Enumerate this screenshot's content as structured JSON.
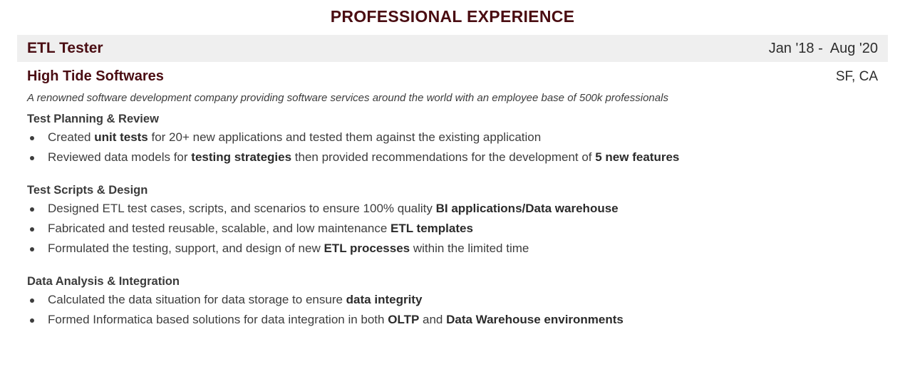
{
  "section": {
    "title": "PROFESSIONAL EXPERIENCE"
  },
  "colors": {
    "heading_maroon": "#4a0d12",
    "header_band_bg": "#efefef",
    "body_text": "#3d3d3d"
  },
  "entry": {
    "job_title": "ETL Tester",
    "dates": "Jan '18 -  Aug '20",
    "company": "High Tide Softwares",
    "location": "SF, CA",
    "description": "A renowned software development company providing software services around the world with an employee base of 500k professionals",
    "groups": [
      {
        "heading": "Test Planning & Review",
        "bullets": [
          [
            {
              "text": "Created ",
              "bold": false
            },
            {
              "text": "unit tests",
              "bold": true
            },
            {
              "text": " for 20+ new applications and tested them against the existing application",
              "bold": false
            }
          ],
          [
            {
              "text": "Reviewed data models for ",
              "bold": false
            },
            {
              "text": "testing strategies",
              "bold": true
            },
            {
              "text": " then provided recommendations for the development of ",
              "bold": false
            },
            {
              "text": "5 new features",
              "bold": true
            }
          ]
        ]
      },
      {
        "heading": "Test Scripts & Design",
        "bullets": [
          [
            {
              "text": "Designed ETL test cases, scripts, and scenarios to ensure 100% quality ",
              "bold": false
            },
            {
              "text": "BI applications/Data warehouse",
              "bold": true
            }
          ],
          [
            {
              "text": "Fabricated and tested reusable, scalable, and low maintenance ",
              "bold": false
            },
            {
              "text": "ETL templates",
              "bold": true
            }
          ],
          [
            {
              "text": "Formulated the testing, support, and design of new ",
              "bold": false
            },
            {
              "text": "ETL processes",
              "bold": true
            },
            {
              "text": " within the limited time",
              "bold": false
            }
          ]
        ]
      },
      {
        "heading": "Data Analysis & Integration",
        "bullets": [
          [
            {
              "text": "Calculated the data situation for data storage to ensure ",
              "bold": false
            },
            {
              "text": "data integrity",
              "bold": true
            }
          ],
          [
            {
              "text": "Formed Informatica based solutions for data integration in both ",
              "bold": false
            },
            {
              "text": "OLTP",
              "bold": true
            },
            {
              "text": " and ",
              "bold": false
            },
            {
              "text": "Data Warehouse environments",
              "bold": true
            }
          ]
        ]
      }
    ]
  }
}
